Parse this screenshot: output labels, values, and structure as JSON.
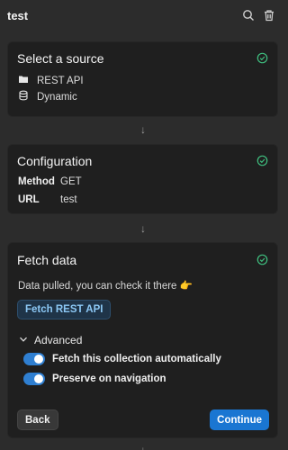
{
  "header": {
    "title": "test",
    "search_icon": "search-icon",
    "delete_icon": "trash-icon"
  },
  "source_card": {
    "title": "Select a source",
    "status_icon": "check-circle-icon",
    "items": [
      {
        "icon": "folder-icon",
        "label": "REST API"
      },
      {
        "icon": "database-icon",
        "label": "Dynamic"
      }
    ]
  },
  "config_card": {
    "title": "Configuration",
    "status_icon": "check-circle-icon",
    "rows": [
      {
        "key": "Method",
        "value": "GET"
      },
      {
        "key": "URL",
        "value": "test"
      }
    ]
  },
  "fetch_card": {
    "title": "Fetch data",
    "status_icon": "check-circle-icon",
    "description": "Data pulled, you can check it there 👉",
    "fetch_button": "Fetch REST API",
    "advanced": {
      "label": "Advanced",
      "expanded": true,
      "options": [
        {
          "label": "Fetch this collection automatically",
          "enabled": true
        },
        {
          "label": "Preserve on navigation",
          "enabled": true
        }
      ]
    },
    "back_label": "Back",
    "continue_label": "Continue"
  },
  "arrow_glyph": "↓",
  "colors": {
    "background": "#2c2c2c",
    "card": "#1f1f1f",
    "success": "#3fbf7f",
    "accent": "#1a76d2",
    "link": "#8cc8f5"
  }
}
